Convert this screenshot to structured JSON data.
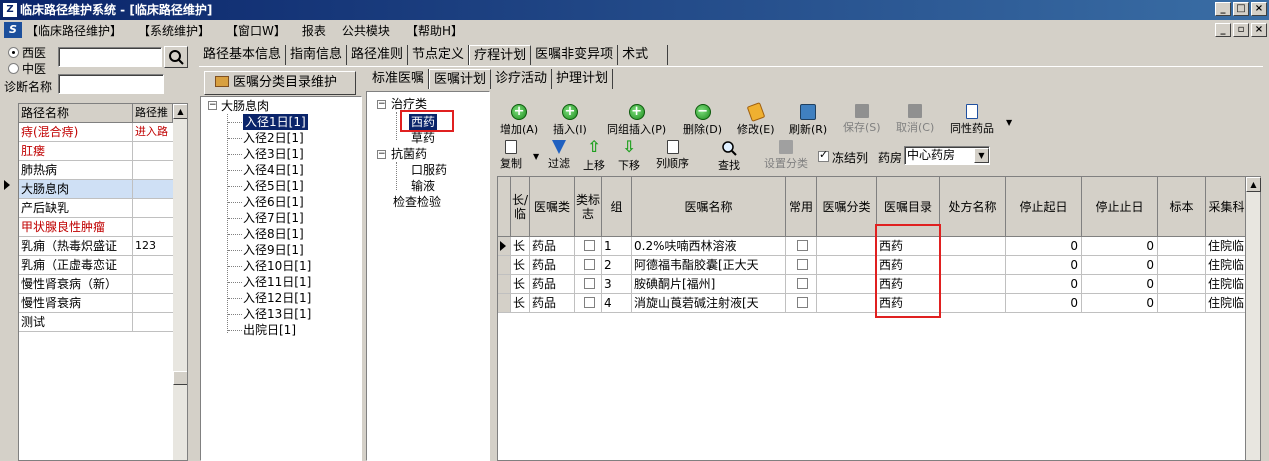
{
  "window": {
    "app_icon": "Z",
    "title": "临床路径维护系统 - [临床路径维护]",
    "buttons": [
      "_",
      "□",
      "×"
    ]
  },
  "menu": {
    "logo": "S",
    "items": [
      "【临床路径维护】",
      "【系统维护】",
      "【窗口W】",
      "报表",
      "公共模块",
      "【帮助H】"
    ],
    "mdi_buttons": [
      "_",
      "▫",
      "×"
    ]
  },
  "left": {
    "radio_western": "西医",
    "radio_chinese": "中医",
    "diag_label": "诊断名称",
    "search_value": "",
    "diag_value": "",
    "grid_headers": [
      "路径名称",
      "路径推"
    ],
    "rows": [
      {
        "name": "痔(混合痔)",
        "status": "进入路",
        "red": true
      },
      {
        "name": "肛瘘",
        "status": "",
        "red": true
      },
      {
        "name": "肺热病",
        "status": "",
        "red": false
      },
      {
        "name": "大肠息肉",
        "status": "",
        "red": false,
        "current": true
      },
      {
        "name": "产后缺乳",
        "status": "",
        "red": false
      },
      {
        "name": "甲状腺良性肿瘤",
        "status": "",
        "red": true
      },
      {
        "name": "乳痈（热毒炽盛证",
        "status": "123",
        "red": false
      },
      {
        "name": "乳痈（正虚毒恋证",
        "status": "",
        "red": false
      },
      {
        "name": "慢性肾衰病（新）",
        "status": "",
        "red": false
      },
      {
        "name": "慢性肾衰病",
        "status": "",
        "red": false
      },
      {
        "name": "测试",
        "status": "",
        "red": false
      }
    ]
  },
  "top_tabs": [
    "路径基本信息",
    "指南信息",
    "路径准则",
    "节点定义",
    "疗程计划",
    "医嘱非变异项",
    "术式"
  ],
  "top_tab_active": 4,
  "cat_button": "医嘱分类目录维护",
  "path_tree": {
    "root": "大肠息肉",
    "days": [
      "入径1日[1]",
      "入径2日[1]",
      "入径3日[1]",
      "入径4日[1]",
      "入径5日[1]",
      "入径6日[1]",
      "入径7日[1]",
      "入径8日[1]",
      "入径9日[1]",
      "入径10日[1]",
      "入径11日[1]",
      "入径12日[1]",
      "入径13日[1]",
      "出院日[1]"
    ]
  },
  "sub_tabs": [
    "标准医嘱",
    "医嘱计划",
    "诊疗活动",
    "护理计划"
  ],
  "sub_tab_active": 1,
  "cat_tree": {
    "n1": "治疗类",
    "n1_children": [
      "西药",
      "草药"
    ],
    "n2": "抗菌药",
    "n2_children": [
      "口服药",
      "输液"
    ],
    "n3": "检查检验"
  },
  "toolbar1": [
    {
      "label": "增加(A)",
      "icon": "add-icon"
    },
    {
      "label": "插入(I)",
      "icon": "insert-icon"
    },
    {
      "label": "同组插入(P)",
      "icon": "group-insert-icon"
    },
    {
      "label": "删除(D)",
      "icon": "delete-icon"
    },
    {
      "label": "修改(E)",
      "icon": "edit-icon"
    },
    {
      "label": "刷新(R)",
      "icon": "refresh-icon"
    },
    {
      "label": "保存(S)",
      "icon": "save-icon"
    },
    {
      "label": "取消(C)",
      "icon": "cancel-icon"
    },
    {
      "label": "同性药品",
      "icon": "similar-drug-icon"
    }
  ],
  "toolbar2": [
    {
      "label": "复制",
      "icon": "copy-icon"
    },
    {
      "label": "过滤",
      "icon": "filter-icon"
    },
    {
      "label": "上移",
      "icon": "up-arrow-icon"
    },
    {
      "label": "下移",
      "icon": "down-arrow-icon"
    },
    {
      "label": "列顺序",
      "icon": "column-order-icon"
    },
    {
      "label": "查找",
      "icon": "find-icon"
    },
    {
      "label": "设置分类",
      "icon": "set-category-icon"
    }
  ],
  "freeze_label": "冻结列",
  "pharmacy_label": "药房",
  "pharmacy_value": "中心药房",
  "grid": {
    "headers": [
      "长/临",
      "医嘱类",
      "类标志",
      "组",
      "医嘱名称",
      "常用",
      "医嘱分类",
      "医嘱目录",
      "处方名称",
      "停止起日",
      "停止止日",
      "标本",
      "采集科室"
    ],
    "rows": [
      {
        "type": "长",
        "cls": "药品",
        "group": "1",
        "name": "0.2%呋喃西林溶液",
        "catalog": "西药",
        "stop_from": "0",
        "stop_to": "0",
        "dept": "住院临"
      },
      {
        "type": "长",
        "cls": "药品",
        "group": "2",
        "name": "阿德福韦酯胶囊[正大天",
        "catalog": "西药",
        "stop_from": "0",
        "stop_to": "0",
        "dept": "住院临"
      },
      {
        "type": "长",
        "cls": "药品",
        "group": "3",
        "name": "胺碘酮片[福州]",
        "catalog": "西药",
        "stop_from": "0",
        "stop_to": "0",
        "dept": "住院临"
      },
      {
        "type": "长",
        "cls": "药品",
        "group": "4",
        "name": "消旋山莨菪碱注射液[天",
        "catalog": "西药",
        "stop_from": "0",
        "stop_to": "0",
        "dept": "住院临"
      }
    ]
  }
}
